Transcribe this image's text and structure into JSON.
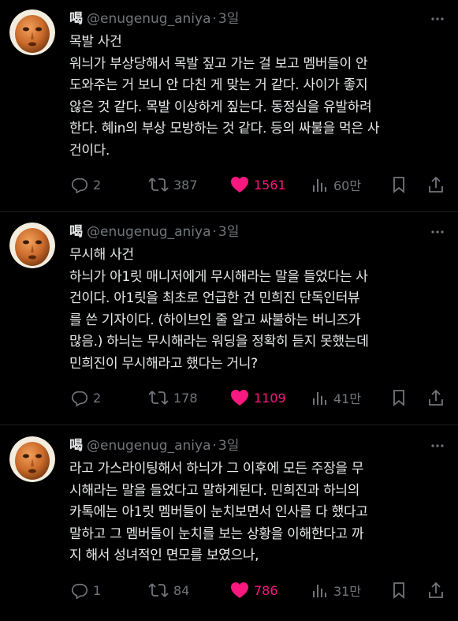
{
  "colors": {
    "background": "#000000",
    "text": "#e7e9ea",
    "muted": "#71767b",
    "like": "#f91880"
  },
  "tweets": [
    {
      "display_name": "喝",
      "handle": "@enugenug_aniya",
      "dot": "·",
      "time": "3일",
      "lines": [
        "목발 사건",
        "워늬가 부상당해서 목발 짚고 가는 걸 보고 멤버들이 안",
        "도와주는 거 보니 안 다친 게 맞는 거 같다. 사이가 좋지",
        "않은 것 같다. 목발 이상하게 짚는다. 동정심을 유발하려",
        "한다. 혜in의 부상 모방하는 것 같다. 등의 싸불을 먹은 사",
        "건이다."
      ],
      "replies": "2",
      "retweets": "387",
      "likes": "1561",
      "views": "60만",
      "icons": [
        "reply-icon",
        "retweet-icon",
        "heart-filled-icon",
        "views-icon",
        "bookmark-icon",
        "share-icon"
      ]
    },
    {
      "display_name": "喝",
      "handle": "@enugenug_aniya",
      "dot": "·",
      "time": "3일",
      "lines": [
        "무시해 사건",
        "하늬가 아1릿 매니저에게 무시해라는 말을 들었다는 사",
        "건이다. 아1릿을 최초로 언급한 건 민희진 단독인터뷰",
        "를 쓴 기자이다. (하이브인 줄 알고 싸불하는 버니즈가",
        "많음.) 하늬는 무시해라는 워딩을 정확히 듣지 못했는데",
        "민희진이 무시해라고 했다는 거니?"
      ],
      "replies": "2",
      "retweets": "178",
      "likes": "1109",
      "views": "41만"
    },
    {
      "display_name": "喝",
      "handle": "@enugenug_aniya",
      "dot": "·",
      "time": "3일",
      "lines": [
        "라고 가스라이팅해서 하늬가 그 이후에 모든 주장을 무",
        "시해라는 말을 들었다고 말하게된다. 민희진과 하늬의",
        "카톡에는 아1릿 멤버들이 눈치보면서 인사를 다 했다고",
        "말하고 그 멤버들이 눈치를 보는 상황을 이해한다고 까",
        "지 해서 성녀적인 면모를 보였으나,"
      ],
      "replies": "1",
      "retweets": "84",
      "likes": "786",
      "views": "31만"
    }
  ]
}
